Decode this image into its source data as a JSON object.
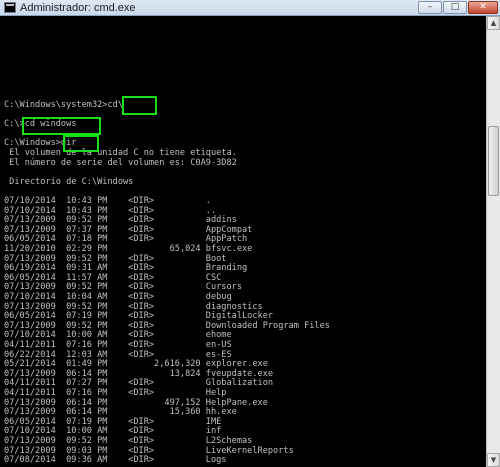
{
  "window": {
    "title": "Administrador: cmd.exe",
    "minimize_glyph": "–",
    "maximize_glyph": "□",
    "close_glyph": "✕"
  },
  "console": {
    "lines": [
      "C:\\Windows\\system32>cd\\",
      "",
      "C:\\>cd windows",
      "",
      "C:\\Windows>dir",
      " El volumen de la unidad C no tiene etiqueta.",
      " El número de serie del volumen es: C0A9-3D82",
      "",
      " Directorio de C:\\Windows",
      "",
      "07/10/2014  10:43 PM    <DIR>          .",
      "07/10/2014  10:43 PM    <DIR>          ..",
      "07/13/2009  09:52 PM    <DIR>          addins",
      "07/13/2009  07:37 PM    <DIR>          AppCompat",
      "06/05/2014  07:18 PM    <DIR>          AppPatch",
      "11/20/2010  02:29 PM            65,024 bfsvc.exe",
      "07/13/2009  09:52 PM    <DIR>          Boot",
      "06/19/2014  09:31 AM    <DIR>          Branding",
      "06/05/2014  11:57 AM    <DIR>          CSC",
      "07/13/2009  09:52 PM    <DIR>          Cursors",
      "07/10/2014  10:04 AM    <DIR>          debug",
      "07/13/2009  09:52 PM    <DIR>          diagnostics",
      "06/05/2014  07:19 PM    <DIR>          DigitalLocker",
      "07/13/2009  09:52 PM    <DIR>          Downloaded Program Files",
      "07/10/2014  10:00 AM    <DIR>          ehome",
      "04/11/2011  07:16 PM    <DIR>          en-US",
      "06/22/2014  12:03 AM    <DIR>          es-ES",
      "05/21/2014  01:49 PM         2,616,320 explorer.exe",
      "07/13/2009  06:14 PM            13,824 fveupdate.exe",
      "04/11/2011  07:27 PM    <DIR>          Globalization",
      "04/11/2011  07:16 PM    <DIR>          Help",
      "07/13/2009  06:14 PM           497,152 HelpPane.exe",
      "07/13/2009  06:14 PM            15,360 hh.exe",
      "06/05/2014  07:19 PM    <DIR>          IME",
      "07/10/2014  10:00 AM    <DIR>          inf",
      "07/13/2009  09:52 PM    <DIR>          L2Schemas",
      "07/13/2009  09:03 PM    <DIR>          LiveKernelReports",
      "07/08/2014  09:36 AM    <DIR>          Logs"
    ]
  },
  "highlights": {
    "color": "#16e016"
  },
  "scrollbar": {
    "up_glyph": "▲",
    "down_glyph": "▼"
  }
}
